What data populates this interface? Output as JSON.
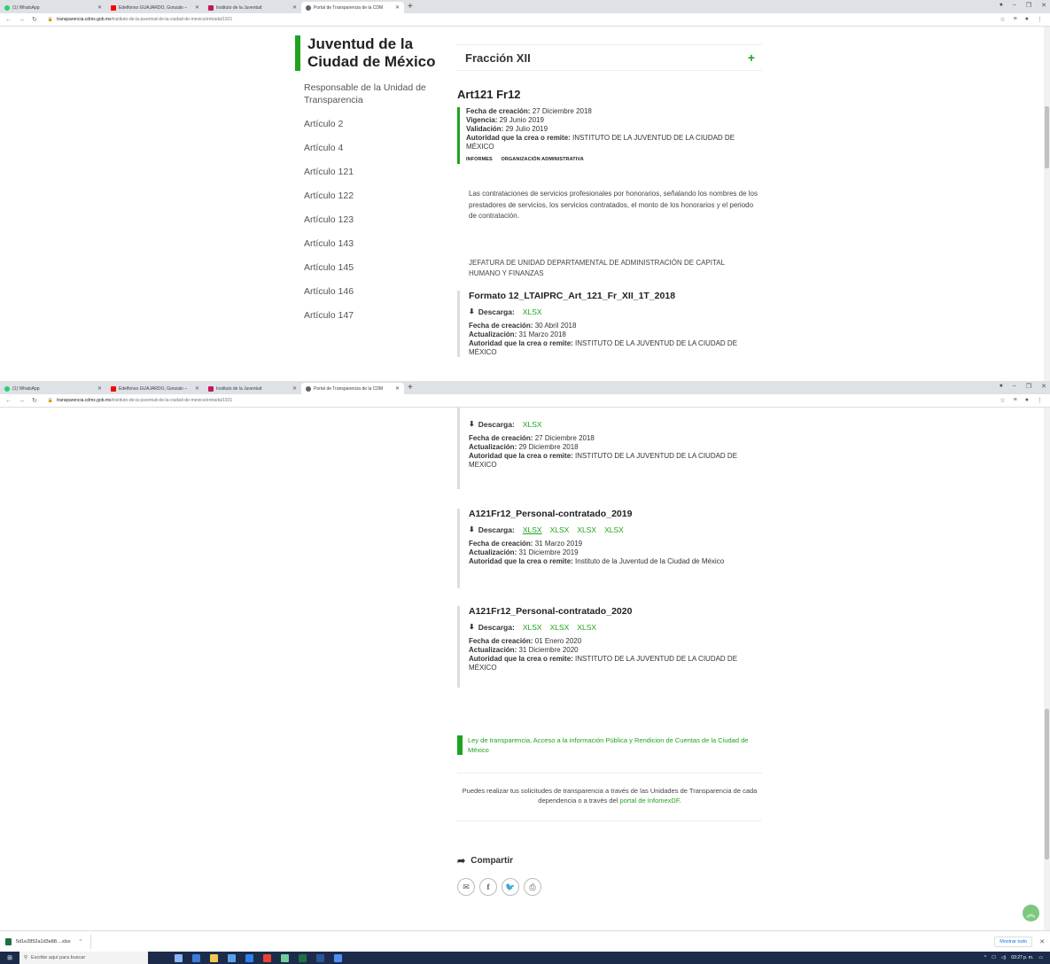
{
  "browser": {
    "tabs": [
      {
        "label": "(1) WhatsApp",
        "icon": "whatsapp-icon",
        "color": "#25d366"
      },
      {
        "label": "Edelfonso GUAJARDO, Gonzalo –",
        "icon": "youtube-icon",
        "color": "#ff0000"
      },
      {
        "label": "Instituto de la Juventud",
        "icon": "site-icon",
        "color": "#c2185b"
      },
      {
        "label": "Portal de Transparencia de la CDM",
        "icon": "globe-icon",
        "color": "#5f6368"
      }
    ],
    "url_host": "transparencia.cdmx.gob.mx",
    "url_path": "/instituto-de-la-juventud-de-la-ciudad-de-mexico/entrada/1921"
  },
  "site": {
    "title": "Juventud de la Ciudad de México"
  },
  "sidebar": {
    "items": [
      "Responsable de la Unidad de Transparencia",
      "Artículo 2",
      "Artículo 4",
      "Artículo 121",
      "Artículo 122",
      "Artículo 123",
      "Artículo 143",
      "Artículo 145",
      "Artículo 146",
      "Artículo 147"
    ]
  },
  "fraccion": {
    "title": "Fracción XII",
    "toggle": "+"
  },
  "article": {
    "title": "Art121 Fr12",
    "labels": {
      "creacion": "Fecha de creación:",
      "vigencia": "Vigencia:",
      "validacion": "Validación:",
      "autoridad": "Autoridad que la crea o remite:",
      "actualizacion": "Actualización:",
      "descarga": "Descarga:"
    },
    "fecha_creacion": "27 Diciembre 2018",
    "vigencia": "29 Junio 2019",
    "validacion": "29 Julio 2019",
    "autoridad": "INSTITUTO DE LA JUVENTUD DE LA CIUDAD DE MÉXICO",
    "tags": [
      "INFORMES",
      "ORGANIZACIÓN ADMINISTRATIVA"
    ],
    "description": "Las contrataciones de servicios profesionales por honorarios, señalando los nombres de los prestadores de servicios, los servicios contratados, el monto de los honorarios y el periodo de contratación.",
    "area": "JEFATURA DE UNIDAD DEPARTAMENTAL DE ADMINISTRACIÓN DE CAPITAL HUMANO Y FINANZAS"
  },
  "formats": [
    {
      "title": "Formato 12_LTAIPRC_Art_121_Fr_XII_1T_2018",
      "downloads": [
        "XLSX"
      ],
      "creacion": "30 Abril 2018",
      "actualizacion": "31 Marzo 2018",
      "autoridad": "INSTITUTO DE LA JUVENTUD DE LA CIUDAD DE MÉXICO"
    },
    {
      "title": "",
      "downloads": [
        "XLSX"
      ],
      "creacion": "27 Diciembre 2018",
      "actualizacion": "29 Diciembre 2018",
      "autoridad": "INSTITUTO DE LA JUVENTUD DE LA CIUDAD DE MEXICO"
    },
    {
      "title": "A121Fr12_Personal-contratado_2019",
      "downloads": [
        "XLSX",
        "XLSX",
        "XLSX",
        "XLSX"
      ],
      "creacion": "31 Marzo 2019",
      "actualizacion": "31 Diciembre 2019",
      "autoridad": "Instituto de la Juventud de la Ciudad de México"
    },
    {
      "title": "A121Fr12_Personal-contratado_2020",
      "downloads": [
        "XLSX",
        "XLSX",
        "XLSX"
      ],
      "creacion": "01 Enero 2020",
      "actualizacion": "31 Diciembre 2020",
      "autoridad": "INSTITUTO DE LA JUVENTUD DE LA CIUDAD DE MÉXICO"
    }
  ],
  "footer": {
    "law_link": "Ley de transparencia, Acceso a la información Pública y Rendicion de Cuentas de la Ciudad de México",
    "info_text": "Puedes realizar tus solicitudes de transparencia a través de las Unidades de Transparencia de cada dependencia o a través del",
    "info_link": "portal de InfomexDF",
    "info_end": ".",
    "share_label": "Compartir"
  },
  "downloads_bar": {
    "file": "5d1e2852a1d3e88....xlsx",
    "show_all": "Mostrar todo"
  },
  "taskbar": {
    "search_placeholder": "Escribe aquí para buscar",
    "time": "03:27 p. m."
  },
  "colors": {
    "accent": "#1fa31f",
    "taskbar": "#1c2b4a"
  }
}
